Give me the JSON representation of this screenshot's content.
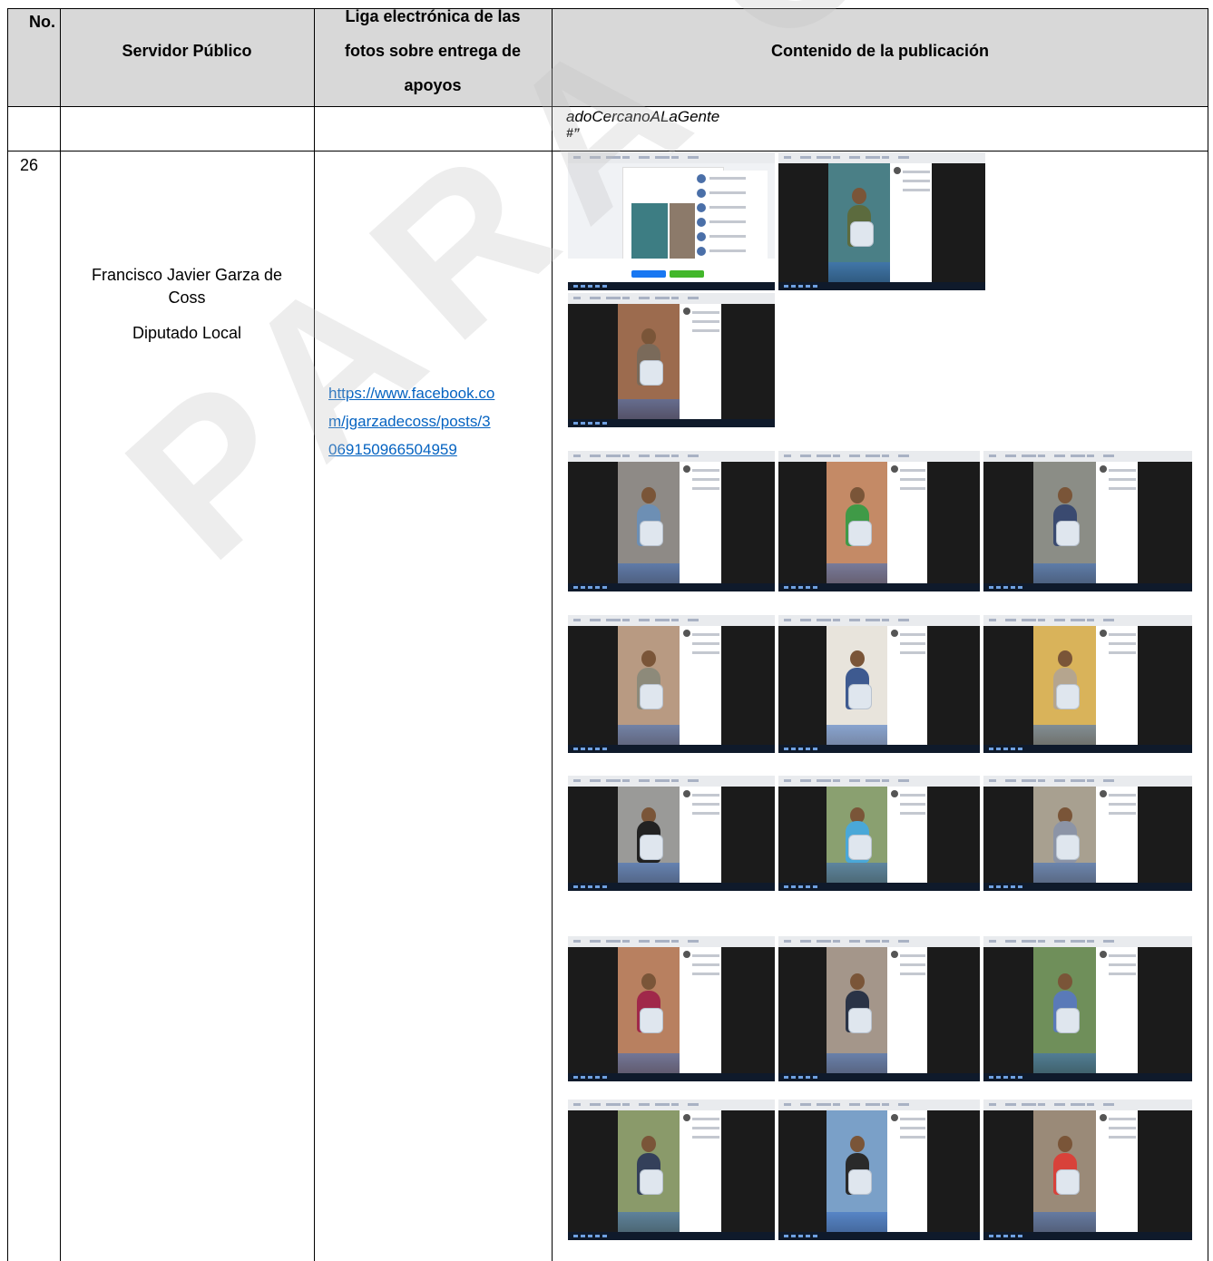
{
  "table": {
    "headers": {
      "no": "No.",
      "servidor": "Servidor Público",
      "liga_line1": "Liga electrónica de las",
      "liga_line2": "fotos sobre entrega de",
      "liga_line3": "apoyos",
      "contenido": "Contenido de la publicación"
    },
    "continuation_row": {
      "content_line1": "adoCercanoALaGente",
      "content_line2": "#”"
    },
    "row": {
      "number": "26",
      "servant_name_line1": "Francisco Javier Garza de",
      "servant_name_line2": "Coss",
      "servant_position": "Diputado Local",
      "link_line1": "https://www.facebook.co",
      "link_line2": "m/jgarzadecoss/posts/3",
      "link_line3": "069150966504959"
    }
  },
  "watermark": "PARA CONSULTA",
  "colors": {
    "header_bg": "#d8d8d8",
    "link": "#0563c1",
    "screenshot_bg": "#1b1b1b"
  }
}
